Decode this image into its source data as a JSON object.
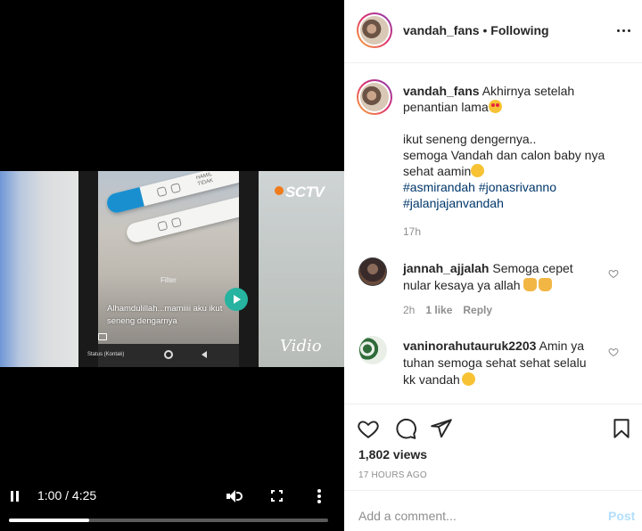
{
  "video": {
    "time_display": "1:00 / 4:25",
    "progress": 0.25,
    "caption": "Alhamdulillah...mamiiii aku ikut seneng dengarnya",
    "filter_label": "Filter",
    "status_label": "Status (Kontak)",
    "channel_logo": "SCTV",
    "watermark": "Vidio",
    "test_marks": [
      "HAMIL",
      "TIDAK"
    ]
  },
  "post": {
    "author": "vandah_fans",
    "follow_state": "Following",
    "separator": "•",
    "caption_lines": [
      "Akhirnya setelah",
      "penantian lama"
    ],
    "body_lines": [
      "ikut seneng dengernya..",
      "semoga Vandah dan calon baby nya",
      "sehat aamin"
    ],
    "hashtags": [
      "#asmirandah",
      "#jonasrivanno",
      "#jalanjajanvandah"
    ],
    "caption_age": "17h"
  },
  "comments": [
    {
      "user": "jannah_ajjalah",
      "text_lines": [
        "Semoga cepet",
        "nular kesaya ya allah"
      ],
      "age": "2h",
      "likes": "1 like",
      "reply": "Reply"
    },
    {
      "user": "vaninorahutauruk2203",
      "text_lines": [
        "Amin ya",
        "tuhan semoga sehat sehat selalu",
        "kk vandah"
      ],
      "age": "",
      "likes": "",
      "reply": ""
    }
  ],
  "stats": {
    "views": "1,802 views",
    "posted": "17 HOURS AGO"
  },
  "composer": {
    "placeholder": "Add a comment...",
    "post_label": "Post"
  },
  "colors": {
    "accent": "#0095f6",
    "post_disabled": "#b2dffc",
    "hashtag": "#00376b",
    "muted": "#8e8e8e"
  },
  "icons": [
    "pause-icon",
    "volume-icon",
    "fullscreen-icon",
    "more-vertical-icon",
    "more-horizontal-icon",
    "heart-icon",
    "comment-icon",
    "share-icon",
    "bookmark-icon"
  ]
}
